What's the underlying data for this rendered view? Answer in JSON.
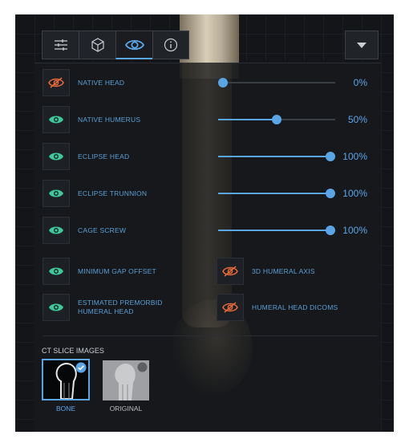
{
  "toolbar": {
    "tabs": [
      {
        "name": "settings",
        "icon": "sliders-icon"
      },
      {
        "name": "3d-view",
        "icon": "cube-icon"
      },
      {
        "name": "visibility",
        "icon": "eye-icon"
      },
      {
        "name": "info",
        "icon": "info-icon"
      }
    ],
    "dropdown_icon": "chevron-down-icon"
  },
  "layers": [
    {
      "label": "NATIVE HEAD",
      "value": "0%",
      "fraction": 0.0,
      "visible": false
    },
    {
      "label": "NATIVE HUMERUS",
      "value": "50%",
      "fraction": 0.5,
      "visible": true
    },
    {
      "label": "ECLIPSE HEAD",
      "value": "100%",
      "fraction": 1.0,
      "visible": true
    },
    {
      "label": "ECLIPSE TRUNNION",
      "value": "100%",
      "fraction": 1.0,
      "visible": true
    },
    {
      "label": "CAGE SCREW",
      "value": "100%",
      "fraction": 1.0,
      "visible": true
    }
  ],
  "toggles": [
    {
      "label": "MINIMUM GAP OFFSET",
      "visible": true
    },
    {
      "label": "3D HUMERAL AXIS",
      "visible": false
    },
    {
      "label": "ESTIMATED PREMORBID HUMERAL HEAD",
      "visible": true
    },
    {
      "label": "HUMERAL HEAD DICOMS",
      "visible": false
    }
  ],
  "ct_slice": {
    "title": "CT SLICE IMAGES",
    "options": [
      {
        "label": "BONE",
        "selected": true
      },
      {
        "label": "ORIGINAL",
        "selected": false
      }
    ]
  },
  "colors": {
    "accent": "#5aa5e6",
    "visible": "#3ec99a",
    "hidden": "#e8693a"
  }
}
